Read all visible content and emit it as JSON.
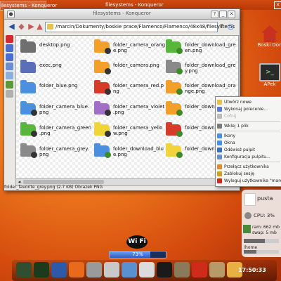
{
  "taskbar": {
    "items": [
      {
        "label": "ilesystems - Konqueror",
        "active": true
      },
      {
        "label": "filesystems - Konqueror",
        "active": false
      }
    ]
  },
  "window": {
    "title": "filesystems - Konqueror",
    "url": "/marcin/Dokumenty/boskie prace/Flamenco/Flamenco/48x48/filesystems",
    "status": "folder_favorite_grey.png (2.7 KB)  Obrazek PNG"
  },
  "files": [
    {
      "name": "desktop.png",
      "color": "#6f6f6f",
      "badge": ""
    },
    {
      "name": "folder_camera_orange.png",
      "color": "#f3a02a",
      "badge": "#333"
    },
    {
      "name": "folder_download_green.png",
      "color": "#58b63a",
      "badge": "#3d8b2a"
    },
    {
      "name": "exec.png",
      "color": "#5b6fb8",
      "badge": ""
    },
    {
      "name": "folder_camera.png",
      "color": "#f3a02a",
      "badge": "#333"
    },
    {
      "name": "folder_download_grey.png",
      "color": "#8a8a8a",
      "badge": "#3d8b2a"
    },
    {
      "name": "folder_blue.png",
      "color": "#4a8fe0",
      "badge": ""
    },
    {
      "name": "folder_camera_red.png",
      "color": "#d63b2a",
      "badge": "#333"
    },
    {
      "name": "folder_download_orange.png",
      "color": "#f3a02a",
      "badge": "#3d8b2a"
    },
    {
      "name": "folder_camera_blue.png",
      "color": "#4a8fe0",
      "badge": "#333"
    },
    {
      "name": "folder_camera_violet.png",
      "color": "#a16fc6",
      "badge": "#333"
    },
    {
      "name": "folder_download...",
      "color": "#f3a02a",
      "badge": "#3d8b2a"
    },
    {
      "name": "folder_camera_green.png",
      "color": "#58b63a",
      "badge": "#333"
    },
    {
      "name": "folder_camera_yellow.png",
      "color": "#f0d43a",
      "badge": "#333"
    },
    {
      "name": "folder_download...",
      "color": "#d63b2a",
      "badge": "#3d8b2a"
    },
    {
      "name": "folder_camera_grey.png",
      "color": "#8a8a8a",
      "badge": "#333"
    },
    {
      "name": "folder_download_blue.png",
      "color": "#4a8fe0",
      "badge": "#3d8b2a"
    },
    {
      "name": "folder_download...",
      "color": "#f0d43a",
      "badge": "#3d8b2a"
    }
  ],
  "context_menu": {
    "items": [
      {
        "label": "Utwórz nowe",
        "disabled": false,
        "icon": "new-icon",
        "color": "#e8c04a"
      },
      {
        "label": "Wykonaj polecenie...",
        "disabled": false,
        "icon": "run-icon",
        "color": "#5a7ad0"
      },
      {
        "label": "Cofnij",
        "disabled": true,
        "icon": "undo-icon",
        "color": "#bbbbbb"
      },
      {
        "label": "Wklej 1 plik",
        "disabled": false,
        "icon": "paste-icon",
        "color": "#7a7a7a"
      },
      {
        "label": "Ikony",
        "disabled": false,
        "icon": "icons-icon",
        "color": "#4a8fe0"
      },
      {
        "label": "Okna",
        "disabled": false,
        "icon": "windows-icon",
        "color": "#4a8fe0"
      },
      {
        "label": "Odśwież pulpit",
        "disabled": false,
        "icon": "refresh-icon",
        "color": "#3a6fc0"
      },
      {
        "label": "Konfiguracja pulpitu...",
        "disabled": false,
        "icon": "configure-icon",
        "color": "#6a8fd0"
      },
      {
        "label": "Przełącz użytkownika",
        "disabled": false,
        "icon": "switch-user-icon",
        "color": "#e08a2a"
      },
      {
        "label": "Zablokuj sesję",
        "disabled": false,
        "icon": "lock-icon",
        "color": "#c8a030"
      },
      {
        "label": "Wyloguj użytkownika \"marcin\"",
        "disabled": false,
        "icon": "logout-icon",
        "color": "#c03020"
      }
    ]
  },
  "desktop_icons": [
    {
      "label": "Boski Don",
      "color": "#c83020"
    },
    {
      "label": "APek",
      "color": "#2a2a2a"
    }
  ],
  "monitor": {
    "header": "pusta",
    "cpu": "CPU: 3%",
    "ram": "ram: 662 mb",
    "swap": "swap: 5 mb",
    "fs": "/home"
  },
  "wifi": {
    "label": "Wi Fi",
    "progress_label": "73%",
    "progress": 0.73
  },
  "clock": "17:50:33",
  "dock": {
    "items": [
      {
        "icon": "terminal-icon",
        "color": "#2f4f2f"
      },
      {
        "icon": "terminal-icon",
        "color": "#1c3a1c"
      },
      {
        "icon": "psi-icon",
        "color": "#2a5aa8"
      },
      {
        "icon": "firefox-icon",
        "color": "#e86a1a"
      },
      {
        "icon": "news-icon",
        "color": "#9a9a9a"
      },
      {
        "icon": "email-icon",
        "color": "#c8c8c8"
      },
      {
        "icon": "globe-icon",
        "color": "#5a8fd0"
      },
      {
        "icon": "camera-icon",
        "color": "#dcdcdc"
      },
      {
        "icon": "inkscape-icon",
        "color": "#1a1a1a"
      },
      {
        "icon": "gimp-icon",
        "color": "#8a7a5a"
      },
      {
        "icon": "calendar-icon",
        "color": "#d02a1a"
      },
      {
        "icon": "archive-icon",
        "color": "#b89a6a"
      },
      {
        "icon": "trash-icon",
        "color": "#e8b040"
      }
    ]
  }
}
